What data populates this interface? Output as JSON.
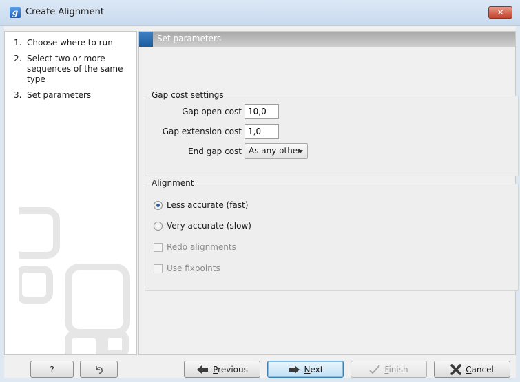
{
  "window": {
    "title": "Create Alignment",
    "app_icon_letter": "g",
    "close_glyph": "✕"
  },
  "steps": [
    {
      "num": "1.",
      "label": "Choose where to run"
    },
    {
      "num": "2.",
      "label": "Select two or more sequences of the same type"
    },
    {
      "num": "3.",
      "label": "Set parameters"
    }
  ],
  "panel": {
    "header": "Set parameters"
  },
  "gap_cost": {
    "title": "Gap cost settings",
    "open_label": "Gap open cost",
    "open_value": "10,0",
    "extension_label": "Gap extension cost",
    "extension_value": "1,0",
    "end_gap_label": "End gap cost",
    "end_gap_value": "As any other"
  },
  "alignment": {
    "title": "Alignment",
    "option_fast": "Less accurate (fast)",
    "option_slow": "Very accurate (slow)",
    "selected": "fast",
    "redo_label": "Redo alignments",
    "fixpoints_label": "Use fixpoints"
  },
  "buttons": {
    "help": "?",
    "previous": "Previous",
    "next": "Next",
    "finish": "Finish",
    "cancel": "Cancel"
  },
  "icons": {
    "help": "help-icon",
    "reset": "reset-icon",
    "previous": "arrow-left-icon",
    "next": "arrow-right-icon",
    "finish": "checkmark-icon",
    "cancel": "cancel-x-icon"
  },
  "colors": {
    "accent": "#1c5c9e",
    "header_bar": "#b5b5b5",
    "close": "#c4412a"
  }
}
